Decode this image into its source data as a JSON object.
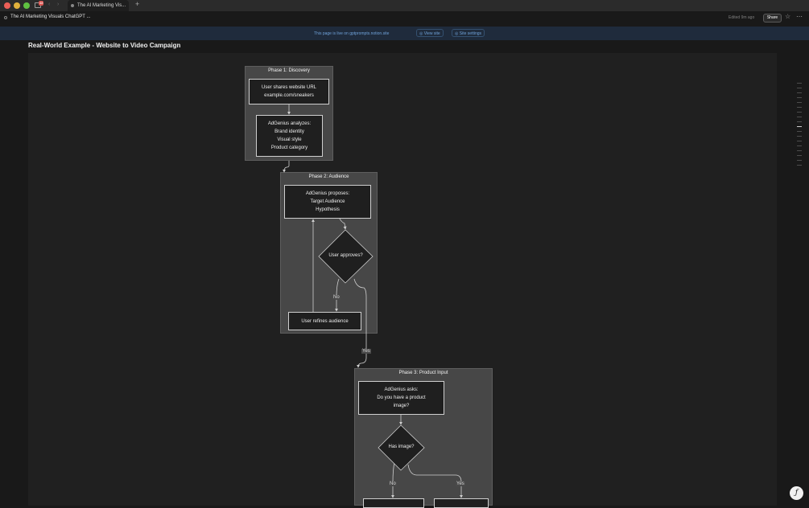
{
  "browser": {
    "tab_title": "The AI Marketing Vis...",
    "badge_count": "48"
  },
  "topbar": {
    "page_title": "The AI Marketing Visuals ChatGPT ...",
    "edited": "Edited 9m ago",
    "share_label": "Share"
  },
  "banner": {
    "message": "This page is live on gptprompts.notion.site",
    "view_site": "View site",
    "site_settings": "Site settings"
  },
  "page": {
    "title": "Real-World Example - Website to Video Campaign"
  },
  "diagram": {
    "phases": [
      {
        "label": "Phase 1: Discovery"
      },
      {
        "label": "Phase 2: Audience"
      },
      {
        "label": "Phase 3: Product Input"
      }
    ],
    "nodes": {
      "share_url": "User shares website URL\nexample.com/sneakers",
      "analyzes": "AdGenius analyzes:\nBrand identity\nVisual style\nProduct category",
      "proposes": "AdGenius proposes:\nTarget Audience\nHypothesis",
      "approves": "User approves?",
      "refines": "User refines audience",
      "asks": "AdGenius asks:\nDo you have a product\nimage?",
      "has_image": "Has image?"
    },
    "edge_labels": {
      "no_1": "No",
      "yes_1": "Yes",
      "no_2": "No",
      "yes_2": "Yes"
    }
  },
  "colors": {
    "background": "#191919",
    "banner": "#1f2b3c",
    "link": "#6fa1d8",
    "phase_fill": "#474747"
  }
}
